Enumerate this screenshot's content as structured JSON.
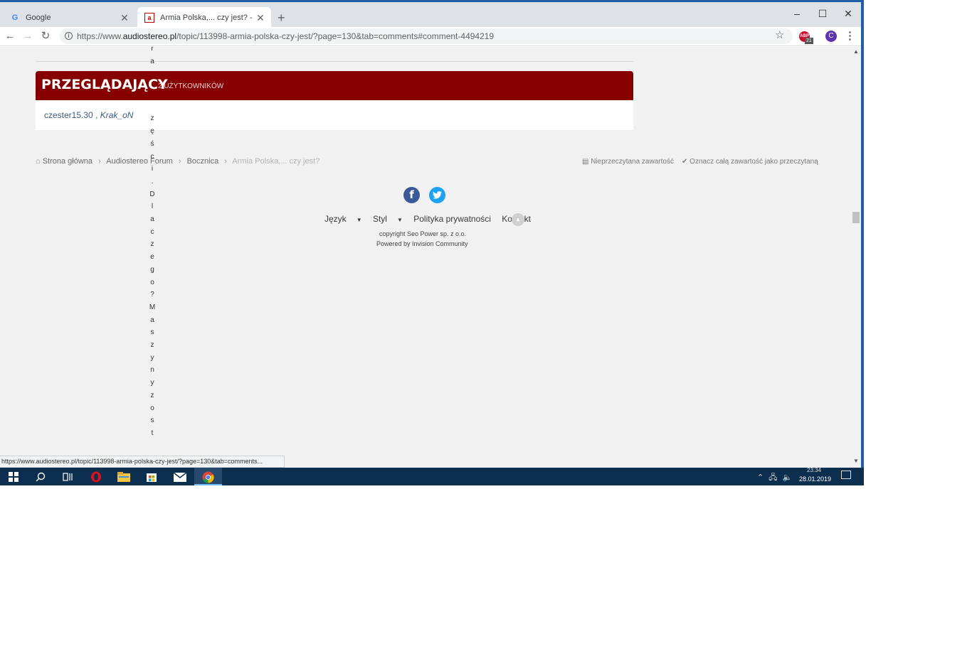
{
  "browser": {
    "tabs": [
      {
        "title": "Google",
        "active": false
      },
      {
        "title": "Armia Polska,... czy jest? - strona",
        "active": true
      }
    ],
    "url_prefix": "https://www.",
    "url_host": "audiostereo.pl",
    "url_path": "/topic/113998-armia-polska-czy-jest/?page=130&tab=comments#comment-4494219",
    "extension_badge": "21",
    "profile_initial": "C",
    "status_url": "https://www.audiostereo.pl/topic/113998-armia-polska-czy-jest/?page=130&tab=comments..."
  },
  "viewers": {
    "title": "PRZEGLĄDAJĄCY",
    "count_label": "2 UŻYTKOWNIKÓW",
    "user1": "czester15.30",
    "separator": ",",
    "user2": "Krak_oN"
  },
  "breadcrumb": {
    "home": "Strona główna",
    "forum": "Audiostereo Forum",
    "section": "Bocznica",
    "current": "Armia Polska,... czy jest?"
  },
  "actions": {
    "unread": "Nieprzeczytana zawartość",
    "mark_read": "Oznacz całą zawartość jako przeczytaną"
  },
  "footer": {
    "language": "Język",
    "style": "Styl",
    "privacy": "Polityka prywatności",
    "contact": "Kontakt",
    "copyright": "copyright Seo Power sp. z o.o.",
    "powered": "Powered by Invision Community"
  },
  "overflow_text": {
    "top": "r\na",
    "bottom": "z\nę\nś\nc\ni\n.\nD\nl\na\nc\nz\ne\ng\no\n?\nM\na\ns\nz\ny\nn\ny\nz\no\ns\nt"
  },
  "taskbar": {
    "time": "23:34",
    "date": "28.01.2019"
  }
}
